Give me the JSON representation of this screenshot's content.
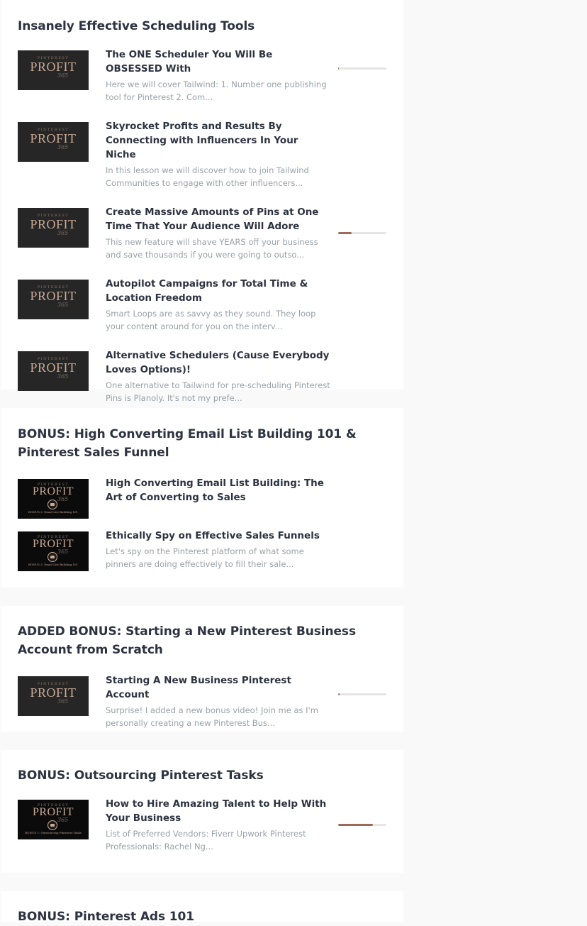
{
  "sections": [
    {
      "title": "Insanely Effective Scheduling Tools",
      "lessons": [
        {
          "title": "The ONE Scheduler You Will Be OBSESSED With",
          "desc": "Here we will cover Tailwind:  1.  Number one publishing tool for Pinterest 2.  Com...",
          "progress": 0.02
        },
        {
          "title": "Skyrocket Profits and Results By Connecting with Influencers In Your Niche",
          "desc": "In this lesson we will discover how to join Tailwind Communities to engage with other influencers..."
        },
        {
          "title": "Create Massive Amounts of Pins at One Time That Your Audience Will Adore",
          "desc": "This new feature will shave YEARS off your business and save thousands if you were going to outso...",
          "progress": 0.28
        },
        {
          "title": "Autopilot Campaigns for Total Time & Location Freedom",
          "desc": "Smart Loops are as savvy as they sound.  They loop your content around for you on the interv..."
        },
        {
          "title": "Alternative Schedulers (Cause Everybody Loves Options)!",
          "desc": "One alternative to Tailwind for pre-scheduling Pinterest Pins is Planoly.  It's not my prefe..."
        }
      ]
    },
    {
      "title": "BONUS: High Converting Email List Building 101 & Pinterest Sales Funnel",
      "lessons": [
        {
          "title": "High Converting Email List Building: The Art of Converting to Sales",
          "desc": ""
        },
        {
          "title": "Ethically Spy on Effective Sales Funnels",
          "desc": "Let's spy on the Pinterest platform of what some pinners are doing effectively to fill their sale..."
        }
      ]
    },
    {
      "title": "ADDED BONUS: Starting a New Pinterest Business Account from Scratch",
      "lessons": [
        {
          "title": "Starting A New Business Pinterest Account",
          "desc": "Surprise!  I added a new bonus video! Join me as I'm personally creating a new Pinterest Bus...",
          "progress": 0.03
        }
      ]
    },
    {
      "title": "BONUS: Outsourcing Pinterest Tasks",
      "lessons": [
        {
          "title": "How to Hire Amazing Talent to Help With Your Business",
          "desc": "List of Preferred Vendors:   Fiverr Upwork   Pinterest Professionals: Rachel Ng...",
          "progress": 0.72
        }
      ]
    },
    {
      "title": "BONUS: Pinterest Ads 101",
      "lessons": []
    }
  ],
  "thumbnails": {
    "brand_top": "PINTEREST",
    "brand_main": "PROFIT",
    "brand_script": "365",
    "caption_email": "BONUS 3: Email List Building 101",
    "caption_outsourcing": "BONUS 1: Outsourcing Pinterest Tasks"
  },
  "colors": {
    "progress_fill": "#9b6a58",
    "progress_track": "#e5e5e5",
    "page_bg": "#f9f9f9",
    "card_bg": "#ffffff"
  }
}
